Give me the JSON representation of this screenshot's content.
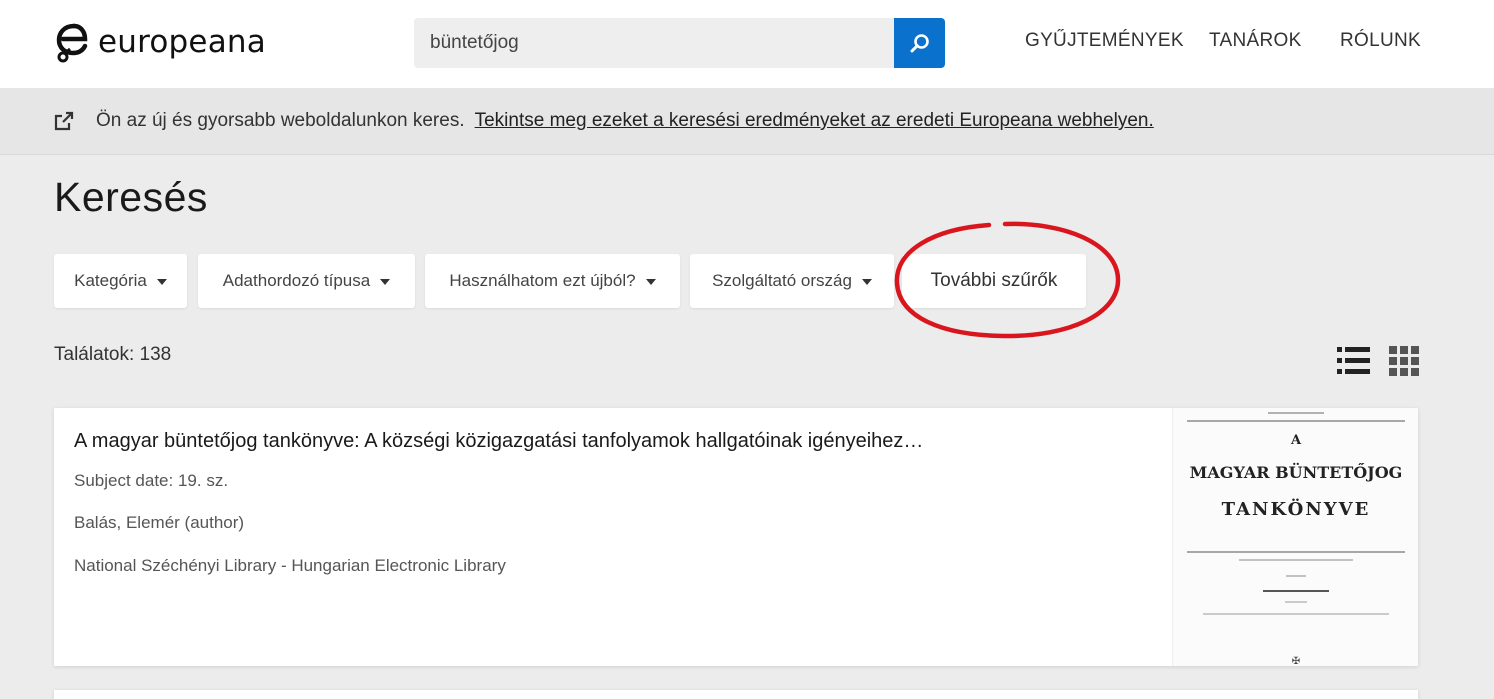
{
  "brand": {
    "name": "europeana"
  },
  "search": {
    "value": "büntetőjog"
  },
  "nav": {
    "collections": "GYŰJTEMÉNYEK",
    "teachers": "TANÁROK",
    "about": "RÓLUNK"
  },
  "notice": {
    "text": "Ön az új és gyorsabb weboldalunkon keres.",
    "link": "Tekintse meg ezeket a keresési eredményeket az eredeti Europeana webhelyen."
  },
  "page": {
    "title": "Keresés"
  },
  "filters": {
    "category": "Kategória",
    "media_type": "Adathordozó típusa",
    "reusability": "Használhatom ezt újból?",
    "provider_country": "Szolgáltató ország",
    "more": "További szűrők"
  },
  "results": {
    "count_label": "Találatok: 138"
  },
  "result": {
    "title": "A magyar büntetőjog tankönyve: A községi közigazgatási tanfolyamok hallgatóinak igényeihez…",
    "subject_date": "Subject date: 19. sz.",
    "author": "Balás, Elemér (author)",
    "provider": "National Széchényi Library - Hungarian Electronic Library",
    "thumbnail": {
      "line1": "A",
      "line2": "MAGYAR BÜNTETŐJOG",
      "line3": "TANKÖNYVE"
    }
  },
  "colors": {
    "accent": "#0a72cc",
    "highlight_ring": "#d9161d",
    "page_bg": "#ececec"
  },
  "icons": {
    "search": "search-icon",
    "external_link": "external-link-icon",
    "list_view": "list-view-icon",
    "grid_view": "grid-view-icon"
  }
}
